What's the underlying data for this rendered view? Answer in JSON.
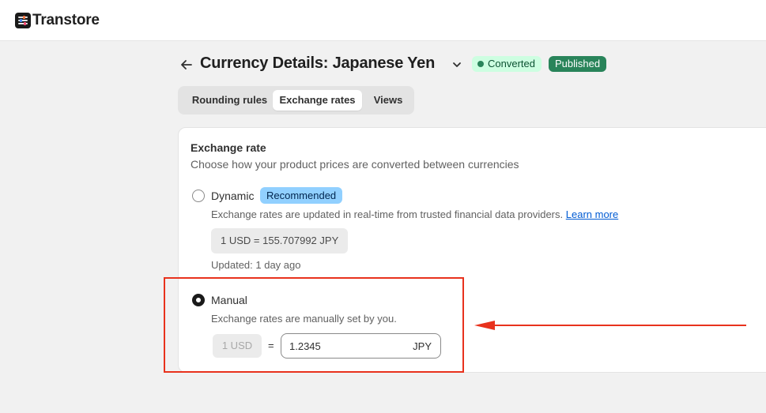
{
  "app": {
    "name": "Transtore",
    "logo_icon": "sliders-icon"
  },
  "header": {
    "title_prefix": "Currency Details:",
    "title_currency": "Japanese Yen",
    "badges": {
      "converted": "Converted",
      "published": "Published"
    }
  },
  "tabs": [
    {
      "label": "Rounding rules",
      "active": false
    },
    {
      "label": "Exchange rates",
      "active": true
    },
    {
      "label": "Views",
      "active": false
    }
  ],
  "exchange_rate": {
    "title": "Exchange rate",
    "subtitle": "Choose how your product prices are converted between currencies",
    "dynamic": {
      "label": "Dynamic",
      "badge": "Recommended",
      "help": "Exchange rates are updated in real-time from trusted financial data providers.",
      "link": "Learn more",
      "rate": "1 USD = 155.707992 JPY",
      "updated": "Updated: 1 day ago",
      "selected": false
    },
    "manual": {
      "label": "Manual",
      "help": "Exchange rates are manually set by you.",
      "base": "1 USD",
      "equals": "=",
      "value": "1.2345",
      "suffix": "JPY",
      "selected": true
    }
  },
  "colors": {
    "accent": "#005bd3",
    "converted_bg": "#cdfee1",
    "published_bg": "#29845a",
    "recommended_bg": "#91d0ff",
    "annotation": "#e8321d"
  }
}
